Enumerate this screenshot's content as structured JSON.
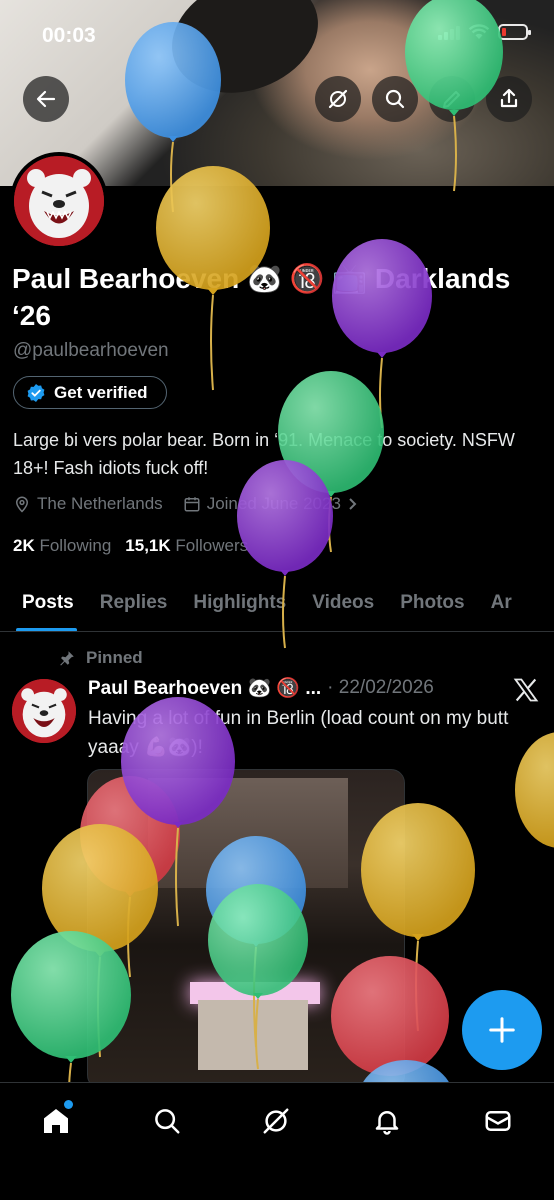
{
  "status": {
    "time": "00:03"
  },
  "profile": {
    "name": "Paul Bearhoeven 🐼 🔞 📺 Darklands ‘26",
    "handle": "@paulbearhoeven",
    "verify_label": "Get verified",
    "bio": "Large bi vers polar bear. Born in ‘91. Menace to society. NSFW 18+! Fash idiots fuck off!",
    "location": "The Netherlands",
    "joined": "Joined June 2023",
    "following_count": "2K",
    "following_label": "Following",
    "followers_count": "15,1K",
    "followers_label": "Followers"
  },
  "tabs": [
    "Posts",
    "Replies",
    "Highlights",
    "Videos",
    "Photos",
    "Ar"
  ],
  "post": {
    "pinned_label": "Pinned",
    "author": "Paul Bearhoeven 🐼 🔞 ...",
    "date": "· 22/02/2026",
    "text": "Having a lot of fun in Berlin (load count on my butt yaaay 💪🏻🐼)!"
  },
  "colors": {
    "accent": "#1d9bf0",
    "background": "#000000",
    "muted": "#71767b"
  },
  "icons": {
    "back": "arrow-left-icon",
    "grok": "grok-icon",
    "search": "search-icon",
    "edit": "pencil-icon",
    "share": "share-icon",
    "x_logo": "x-logo-icon",
    "home": "home-icon",
    "notifications": "bell-icon",
    "messages": "mail-icon"
  }
}
